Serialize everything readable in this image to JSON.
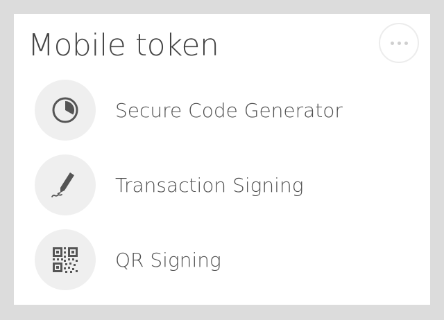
{
  "card": {
    "title": "Mobile token",
    "more_icon": "more-horizontal-icon"
  },
  "menu": {
    "items": [
      {
        "label": "Secure Code Generator",
        "icon": "timer-icon"
      },
      {
        "label": "Transaction Signing",
        "icon": "pen-signature-icon"
      },
      {
        "label": "QR Signing",
        "icon": "qr-code-icon"
      }
    ]
  },
  "colors": {
    "background": "#dcdcdc",
    "card": "#ffffff",
    "icon_circle": "#efefef",
    "icon": "#555555",
    "text": "#444444"
  }
}
